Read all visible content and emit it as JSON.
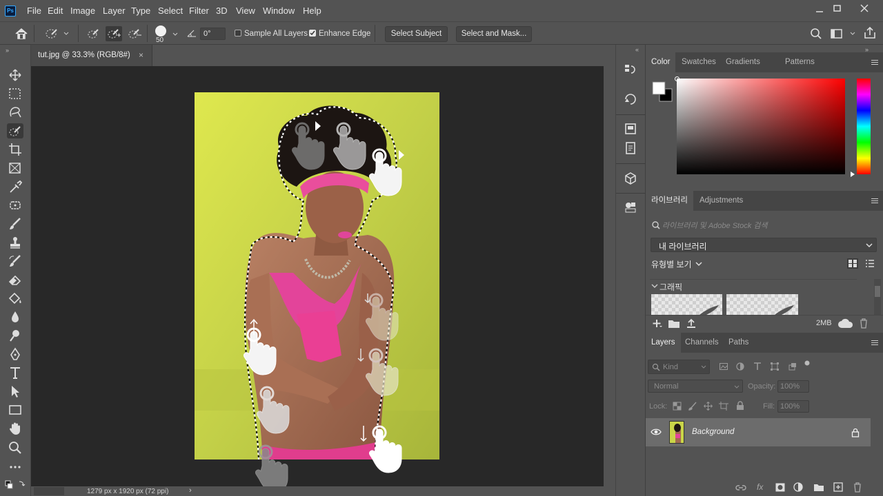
{
  "app": {
    "logo_text": "Ps"
  },
  "menu": [
    "File",
    "Edit",
    "Image",
    "Layer",
    "Type",
    "Select",
    "Filter",
    "3D",
    "View",
    "Window",
    "Help"
  ],
  "options": {
    "brush_size": "50",
    "angle": "0°",
    "sample_all_layers": "Sample All Layers",
    "enhance_edge": "Enhance Edge",
    "select_subject": "Select Subject",
    "select_and_mask": "Select and Mask..."
  },
  "document": {
    "tab_title": "tut.jpg @ 33.3% (RGB/8#)",
    "status": "1279 px x 1920 px (72 ppi)"
  },
  "color_panel": {
    "tabs": [
      "Color",
      "Swatches",
      "Gradients",
      "Patterns"
    ]
  },
  "libraries_panel": {
    "tabs": [
      "라이브러리",
      "Adjustments"
    ],
    "search_placeholder": "라이브러리 및 Adobe Stock 검색",
    "library_select": "내 라이브러리",
    "view_by_type": "유형별 보기",
    "section": "그래픽",
    "storage": "2MB"
  },
  "layers_panel": {
    "tabs": [
      "Layers",
      "Channels",
      "Paths"
    ],
    "filter_kind": "Kind",
    "blend_mode": "Normal",
    "opacity_label": "Opacity:",
    "opacity_value": "100%",
    "lock_label": "Lock:",
    "fill_label": "Fill:",
    "fill_value": "100%",
    "layers": [
      {
        "name": "Background"
      }
    ]
  },
  "colors": {
    "accent": "#31a8ff",
    "canvas_bg": "#282828",
    "panel_bg": "#535353",
    "photo_bg": "#c8d74a",
    "top_swatch": "#ffffff",
    "image_backdrop": "#dfe84e"
  }
}
